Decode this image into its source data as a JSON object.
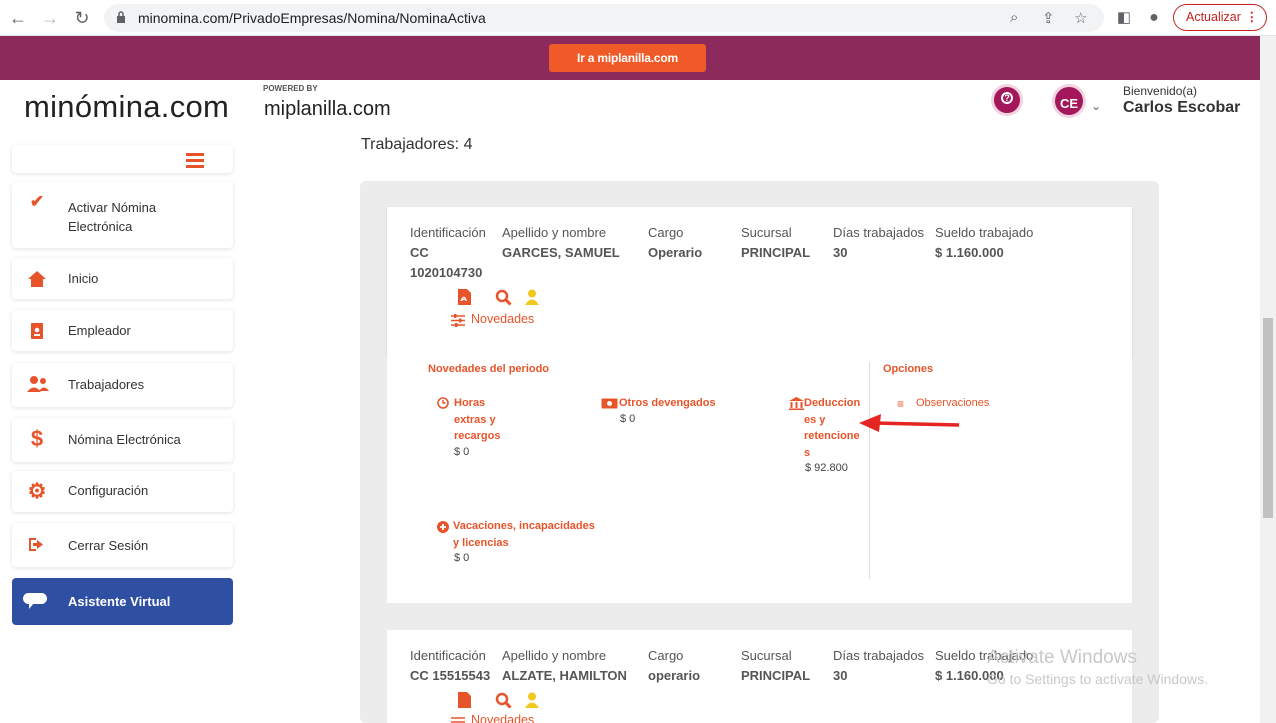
{
  "browser": {
    "url": "minomina.com/PrivadoEmpresas/Nomina/NominaActiva",
    "update_label": "Actualizar"
  },
  "banner": {
    "button_label": "Ir a miplanilla.com"
  },
  "header": {
    "logo": "minómina.com",
    "powered": "POWERED BY",
    "partner": "miplanilla.com",
    "avatar_initials": "CE",
    "welcome": "Bienvenido(a)",
    "user_name": "Carlos Escobar"
  },
  "sidebar": {
    "items": [
      {
        "label": "Activar Nómina Electrónica",
        "icon": "check-icon"
      },
      {
        "label": "Inicio",
        "icon": "home-icon"
      },
      {
        "label": "Empleador",
        "icon": "badge-icon"
      },
      {
        "label": "Trabajadores",
        "icon": "users-icon"
      },
      {
        "label": "Nómina Electrónica",
        "icon": "dollar-icon"
      },
      {
        "label": "Configuración",
        "icon": "gear-icon"
      },
      {
        "label": "Cerrar Sesión",
        "icon": "logout-icon"
      }
    ],
    "assistant_label": "Asistente Virtual"
  },
  "main": {
    "trabajadores_text": "Trabajadores: 4",
    "columns": {
      "id": "Identificación",
      "name": "Apellido y nombre",
      "position": "Cargo",
      "branch": "Sucursal",
      "days": "Días trabajados",
      "salary": "Sueldo trabajado"
    },
    "employees": [
      {
        "id_type": "CC",
        "id_number": "1020104730",
        "name": "GARCES, SAMUEL",
        "position": "Operario",
        "branch": "PRINCIPAL",
        "days": "30",
        "salary": "$ 1.160.000"
      },
      {
        "id_full": "CC 15515543",
        "name": "ALZATE, HAMILTON",
        "position": "operario",
        "branch": "PRINCIPAL",
        "days": "30",
        "salary": "$ 1.160.000"
      }
    ],
    "novedades_label": "Novedades",
    "period": {
      "title": "Novedades del periodo",
      "horas_lines": [
        "Horas",
        "extras y",
        "recargos"
      ],
      "horas_amount": "$ 0",
      "otros_label": "Otros devengados",
      "otros_amount": "$ 0",
      "deduc_lines": [
        "Deduccion",
        "es y",
        "retencione",
        "s"
      ],
      "deduc_amount": "$ 92.800",
      "vac_lines": [
        "Vacaciones, incapacidades",
        "y licencias"
      ],
      "vac_amount": "$ 0"
    },
    "options": {
      "title": "Opciones",
      "observaciones": "Observaciones"
    }
  },
  "watermark": {
    "line1": "Activate Windows",
    "line2": "Go to Settings to activate Windows."
  },
  "colors": {
    "accent": "#e8542a",
    "banner": "#8b2a5b",
    "assistant": "#2f4fa2"
  }
}
